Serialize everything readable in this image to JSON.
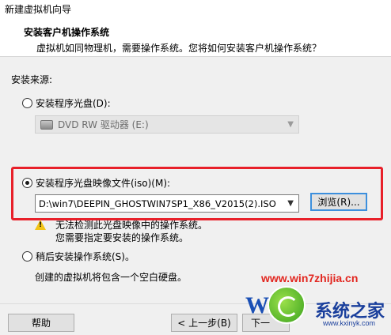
{
  "window": {
    "title": "新建虚拟机向导"
  },
  "header": {
    "title": "安装客户机操作系统",
    "subtitle": "虚拟机如同物理机，需要操作系统。您将如何安装客户机操作系统？"
  },
  "install_source": {
    "label": "安装来源:",
    "disc_option": {
      "label": "安装程序光盘(D):",
      "selected": false
    },
    "disc_drive": {
      "value": "DVD RW 驱动器 (E:)",
      "enabled": false
    },
    "iso_option": {
      "label": "安装程序光盘映像文件(iso)(M):",
      "selected": true
    },
    "iso_path": {
      "value": "D:\\win7\\DEEPIN_GHOSTWIN7SP1_X86_V2015(2).ISO"
    },
    "browse_label": "浏览(R)...",
    "warning_line1": "无法检测此光盘映像中的操作系统。",
    "warning_line2": "您需要指定要安装的操作系统。",
    "later_option": {
      "label": "稍后安装操作系统(S)。",
      "selected": false
    },
    "later_note": "创建的虚拟机将包含一个空白硬盘。"
  },
  "footer": {
    "help_label": "帮助",
    "back_label": "< 上一步(B)",
    "next_label": "下一"
  },
  "watermark": {
    "url": "www.win7zhijia.cn",
    "brand": "系统之家",
    "url2": "www.kxinyk.com"
  },
  "colors": {
    "highlight": "#e8202a",
    "accent": "#3c8fdd",
    "warning": "#f2c417"
  }
}
